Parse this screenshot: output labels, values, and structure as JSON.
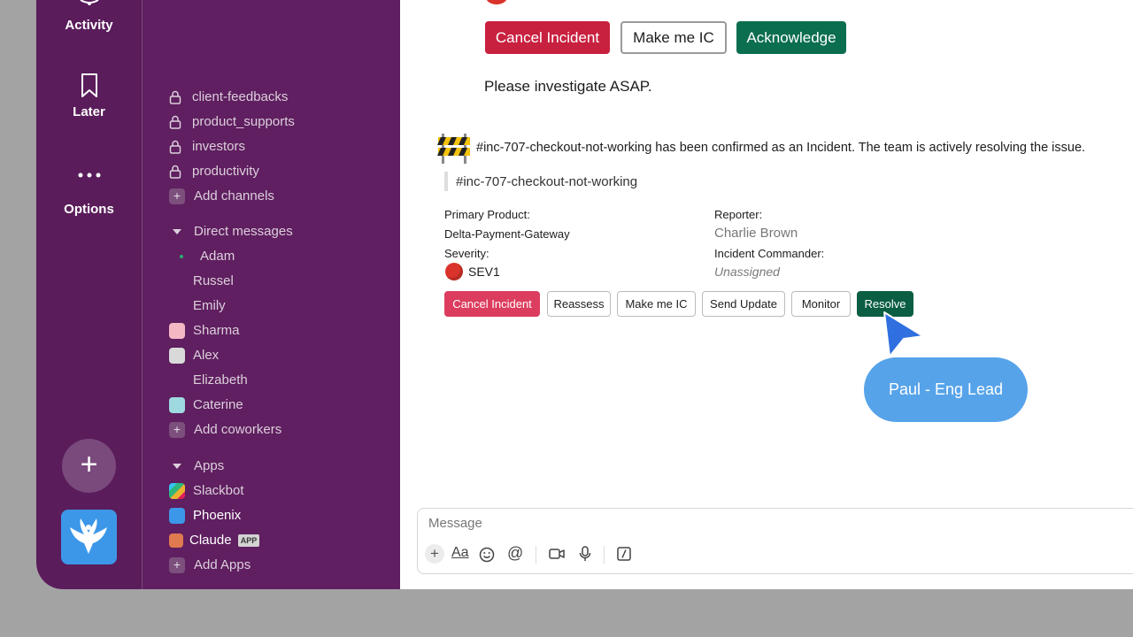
{
  "rail": {
    "activity_label": "Activity",
    "later_label": "Later",
    "options_label": "Options"
  },
  "sidebar": {
    "channels": [
      "client-feedbacks",
      "product_supports",
      "investors",
      "productivity"
    ],
    "add_channels": "Add channels",
    "dm_header": "Direct messages",
    "dms": [
      "Adam",
      "Russel",
      "Emily",
      "Sharma",
      "Alex",
      "Elizabeth",
      "Caterine"
    ],
    "add_coworkers": "Add coworkers",
    "apps_header": "Apps",
    "apps": [
      "Slackbot",
      "Phoenix",
      "Claude"
    ],
    "app_badge": "APP",
    "add_apps": "Add Apps"
  },
  "top_actions": {
    "cancel": "Cancel Incident",
    "make_ic": "Make me IC",
    "acknowledge": "Acknowledge"
  },
  "investigate_text": "Please investigate ASAP.",
  "incident": {
    "confirm_msg": "#inc-707-checkout-not-working has been confirmed as an Incident. The team is actively resolving the issue.",
    "channel_ref": "#inc-707-checkout-not-working",
    "primary_product_label": "Primary Product:",
    "primary_product": "Delta-Payment-Gateway",
    "reporter_label": "Reporter:",
    "reporter": "Charlie Brown",
    "severity_label": "Severity:",
    "severity": "SEV1",
    "commander_label": "Incident Commander:",
    "commander": "Unassigned"
  },
  "incident_actions": {
    "cancel": "Cancel Incident",
    "reassess": "Reassess",
    "make_ic": "Make me IC",
    "send_update": "Send Update",
    "monitor": "Monitor",
    "resolve": "Resolve"
  },
  "composer": {
    "placeholder": "Message"
  },
  "cursor_label": "Paul - Eng Lead",
  "colors": {
    "rail": "#5a1c5b",
    "sidebar": "#5f1f60",
    "danger": "#c8203f",
    "danger_light": "#dc3d5e",
    "success": "#0b6e4f",
    "bubble": "#56a3ea",
    "cursor": "#2f6fe0"
  }
}
